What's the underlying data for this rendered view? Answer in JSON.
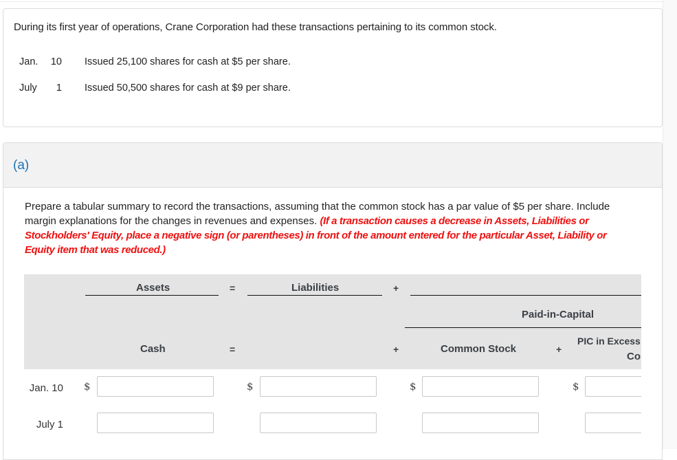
{
  "problem": {
    "intro": "During its first year of operations, Crane Corporation had these transactions pertaining to its common stock.",
    "transactions": [
      {
        "month": "Jan.",
        "day": "10",
        "description": "Issued 25,100 shares for cash at $5 per share."
      },
      {
        "month": "July",
        "day": "1",
        "description": "Issued 50,500 shares for cash at $9 per share."
      }
    ]
  },
  "part": {
    "label": "(a)",
    "instruction": "Prepare a tabular summary to record the transactions, assuming that the common stock has a par value of $5 per share. Include margin explanations for the changes in revenues and expenses. ",
    "instruction_red": "(If a transaction causes a decrease in Assets, Liabilities or Stockholders' Equity, place a negative sign (or parentheses) in front of the amount entered for the particular Asset, Liability or Equity item that was reduced.)",
    "accent_color": "#1a73b5",
    "warning_color": "#ee1111"
  },
  "table": {
    "header": {
      "assets": "Assets",
      "equals": "=",
      "liabilities": "Liabilities",
      "plus": "+",
      "paid_in_capital": "Paid-in-Capital",
      "cash": "Cash",
      "common_stock": "Common Stock",
      "pic_excess_line1": "PIC in Excess",
      "pic_excess_line2": "Co"
    },
    "currency_symbol": "$",
    "rows": [
      {
        "label": "Jan. 10",
        "cash": "",
        "liabilities": "",
        "common_stock": "",
        "pic_excess": ""
      },
      {
        "label": "July 1",
        "cash": "",
        "liabilities": "",
        "common_stock": "",
        "pic_excess": ""
      }
    ]
  }
}
